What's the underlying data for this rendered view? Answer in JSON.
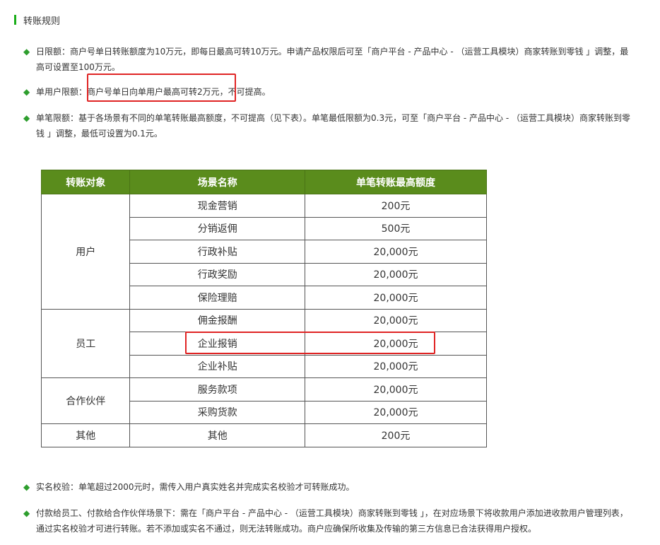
{
  "section": {
    "title": "转账规则"
  },
  "rules_top": [
    {
      "text": "日限额：商户号单日转账额度为10万元，即每日最高可转10万元。申请产品权限后可至「商户平台 - 产品中心 - （运营工具模块）商家转账到零钱 」调整，最高可设置至100万元。"
    },
    {
      "label": "单用户限额：",
      "highlight": "商户号单日向单用户最高可转2万元，",
      "rest": "不可提高。"
    },
    {
      "text": "单笔限额：基于各场景有不同的单笔转账最高额度，不可提高（见下表）。单笔最低限额为0.3元，可至「商户平台 - 产品中心 - （运营工具模块）商家转账到零钱 」调整，最低可设置为0.1元。"
    }
  ],
  "table": {
    "headers": [
      "转账对象",
      "场景名称",
      "单笔转账最高额度"
    ],
    "groups": [
      {
        "target": "用户",
        "rows": [
          [
            "现金营销",
            "200元"
          ],
          [
            "分销返佣",
            "500元"
          ],
          [
            "行政补贴",
            "20,000元"
          ],
          [
            "行政奖励",
            "20,000元"
          ],
          [
            "保险理赔",
            "20,000元"
          ]
        ]
      },
      {
        "target": "员工",
        "rows": [
          [
            "佣金报酬",
            "20,000元"
          ],
          [
            "企业报销",
            "20,000元"
          ],
          [
            "企业补贴",
            "20,000元"
          ]
        ]
      },
      {
        "target": "合作伙伴",
        "rows": [
          [
            "服务款项",
            "20,000元"
          ],
          [
            "采购货款",
            "20,000元"
          ]
        ]
      },
      {
        "target": "其他",
        "rows": [
          [
            "其他",
            "200元"
          ]
        ]
      }
    ]
  },
  "rules_bottom": [
    {
      "text": "实名校验：单笔超过2000元时，需传入用户真实姓名并完成实名校验才可转账成功。"
    },
    {
      "text": "付款给员工、付款给合作伙伴场景下：需在「商户平台 - 产品中心 - （运营工具模块）商家转账到零钱 」，在对应场景下将收款用户添加进收款用户管理列表，通过实名校验才可进行转账。若不添加或实名不通过，则无法转账成功。商户应确保所收集及传输的第三方信息已合法获得用户授权。"
    }
  ],
  "colors": {
    "accent": "#1aad19",
    "header_bg": "#5a8c1c",
    "highlight": "#e02424",
    "bullet": "#2e9e2e"
  }
}
